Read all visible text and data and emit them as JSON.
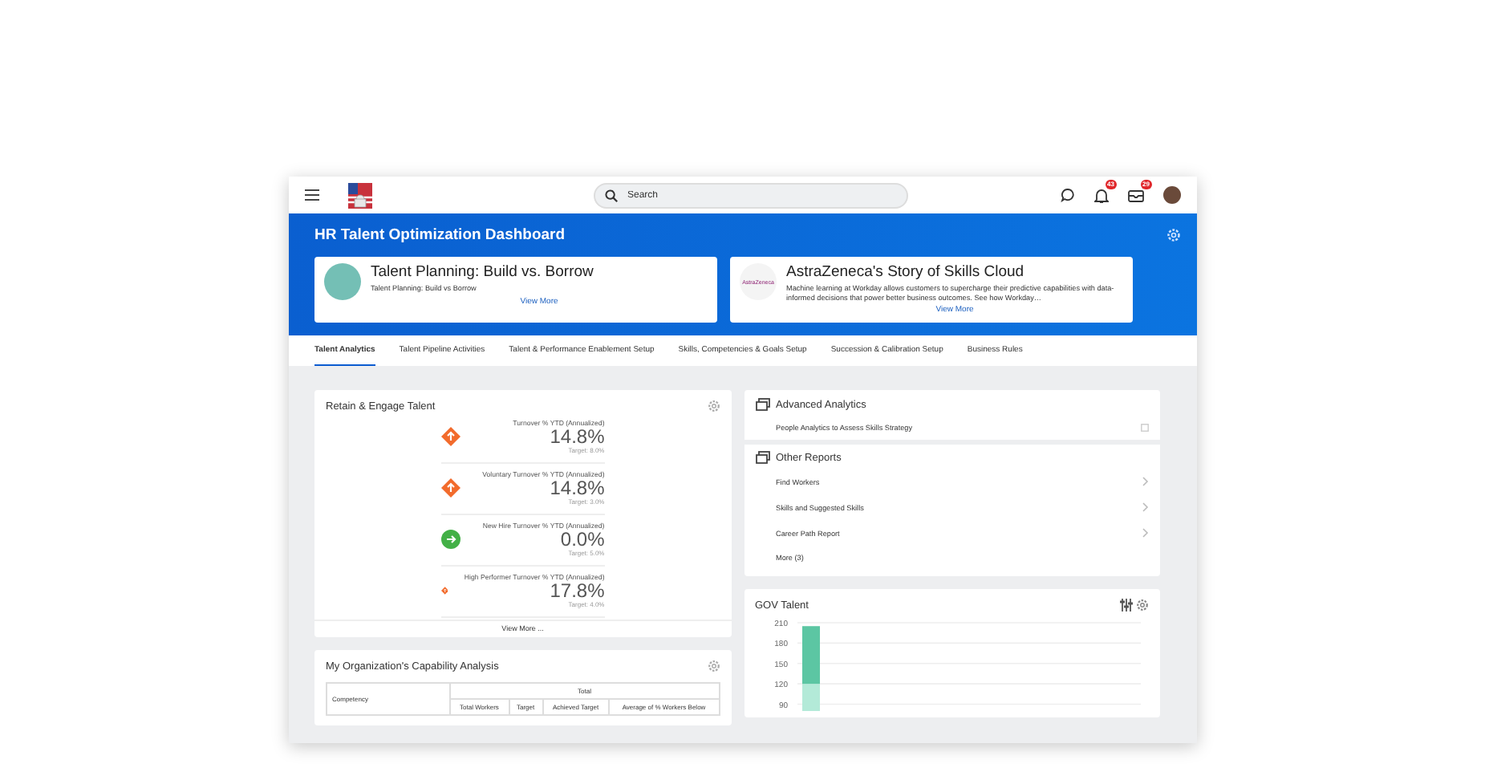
{
  "topbar": {
    "search": {
      "placeholder": "Search"
    },
    "notifications_badge": "43",
    "inbox_badge": "29"
  },
  "header": {
    "title": "HR Talent Optimization Dashboard",
    "promos": [
      {
        "kind": "illustration",
        "title": "Talent Planning: Build vs. Borrow",
        "description": "Talent Planning: Build vs Borrow",
        "link": "View More"
      },
      {
        "kind": "logo",
        "logo_text": "AstraZeneca",
        "title": "AstraZeneca's Story of Skills Cloud",
        "description": "Machine learning at Workday allows customers to supercharge their predictive capabilities with data-informed decisions that power better business outcomes. See how Workday…",
        "link": "View More"
      }
    ]
  },
  "tabs": [
    {
      "label": "Talent Analytics",
      "selected": true
    },
    {
      "label": "Talent Pipeline Activities",
      "selected": false
    },
    {
      "label": "Talent & Performance Enablement Setup",
      "selected": false
    },
    {
      "label": "Skills, Competencies & Goals Setup",
      "selected": false
    },
    {
      "label": "Succession & Calibration Setup",
      "selected": false
    },
    {
      "label": "Business Rules",
      "selected": false
    }
  ],
  "retain": {
    "title": "Retain & Engage Talent",
    "metrics": [
      {
        "kind": "alert",
        "label": "Turnover % YTD (Annualized)",
        "value": "14.8%",
        "target": "Target: 8.0%"
      },
      {
        "kind": "alert",
        "label": "Voluntary Turnover % YTD (Annualized)",
        "value": "14.8%",
        "target": "Target: 3.0%"
      },
      {
        "kind": "ok",
        "label": "New Hire Turnover % YTD (Annualized)",
        "value": "0.0%",
        "target": "Target: 5.0%"
      },
      {
        "kind": "alert",
        "label": "High Performer Turnover % YTD (Annualized)",
        "value": "17.8%",
        "target": "Target: 4.0%"
      }
    ],
    "footer": "View More ..."
  },
  "capability": {
    "title": "My Organization's Capability Analysis",
    "group_header": "Total",
    "columns": [
      "Competency",
      "Total Workers",
      "Target",
      "Achieved Target",
      "Average of % Workers Below"
    ]
  },
  "reports": [
    {
      "title": "Advanced Analytics",
      "items": [
        {
          "kind": "external",
          "label": "People Analytics to Assess Skills Strategy"
        }
      ]
    },
    {
      "title": "Other Reports",
      "items": [
        {
          "kind": "link",
          "label": "Find Workers"
        },
        {
          "kind": "link",
          "label": "Skills and Suggested Skills"
        },
        {
          "kind": "link",
          "label": "Career Path Report"
        },
        {
          "kind": "more",
          "label": "More (3)"
        }
      ]
    }
  ],
  "gov_talent": {
    "title": "GOV Talent",
    "chart_data": {
      "type": "bar",
      "stacked": true,
      "grid": true,
      "ylim": [
        80,
        210
      ],
      "yticks": [
        90,
        120,
        150,
        180,
        210
      ],
      "series": [
        {
          "color": "#b3ead8",
          "values": [
            120
          ]
        },
        {
          "color": "#5cc6a3",
          "values": [
            85
          ]
        }
      ]
    }
  }
}
